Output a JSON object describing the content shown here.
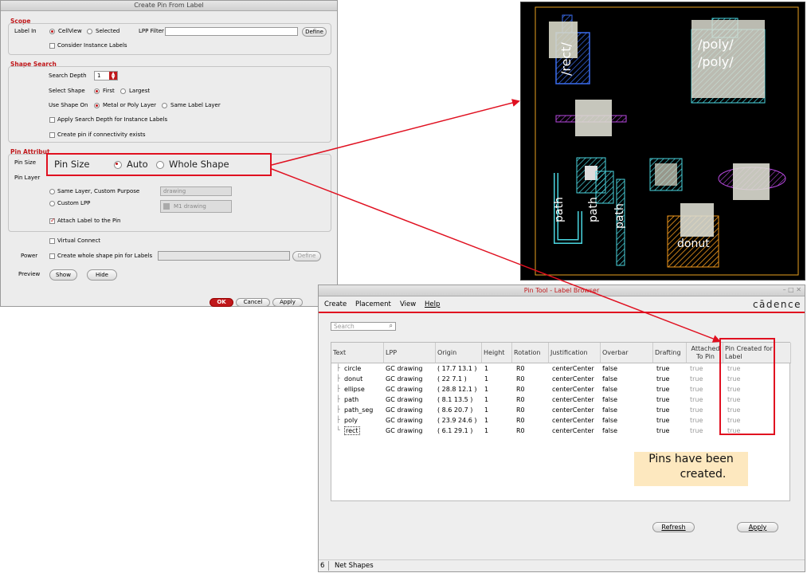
{
  "create_pin_dialog": {
    "title": "Create Pin From Label",
    "scope": {
      "section": "Scope",
      "label_in": "Label In",
      "cellview": "CellView",
      "selected": "Selected",
      "lpp_filter": "LPP Filter",
      "lpp_filter_value": "",
      "define": "Define",
      "consider_instance_labels": "Consider Instance Labels"
    },
    "shape_search": {
      "section": "Shape Search",
      "search_depth": "Search Depth",
      "search_depth_value": "1",
      "select_shape": "Select Shape",
      "first": "First",
      "largest": "Largest",
      "use_shape_on": "Use Shape On",
      "metal_or_poly": "Metal or Poly Layer",
      "same_label_layer": "Same Label Layer",
      "apply_search_depth": "Apply Search Depth for Instance Labels",
      "create_pin_if_connectivity": "Create pin if connectivity exists"
    },
    "pin_attributes": {
      "section": "Pin Attribut",
      "pin_size": "Pin Size",
      "pin_layer": "Pin Layer",
      "same_layer_custom_purpose": "Same Layer, Custom Purpose",
      "custom_purpose_value": "drawing",
      "custom_lpp": "Custom LPP",
      "custom_lpp_value": "M1 drawing",
      "attach_label": "Attach Label to the Pin"
    },
    "virtual_connect": "Virtual Connect",
    "power": "Power",
    "create_whole_shape_pin": "Create whole shape pin for Labels",
    "power_define": "Define",
    "preview": "Preview",
    "show": "Show",
    "hide": "Hide",
    "ok": "OK",
    "cancel": "Cancel",
    "apply": "Apply"
  },
  "zoom_callout": {
    "pin_size": "Pin Size",
    "auto": "Auto",
    "whole_shape": "Whole Shape"
  },
  "layout_view": {
    "labels": [
      "/rect/",
      "/poly/",
      "/poly/",
      "path",
      "path",
      "path",
      "donut"
    ]
  },
  "pin_tool": {
    "title": "Pin Tool - Label Browser",
    "menu": [
      "Create",
      "Placement",
      "View",
      "Help"
    ],
    "brand": "cādence",
    "search_placeholder": "Search",
    "columns": [
      "Text",
      "LPP",
      "Origin",
      "Height",
      "Rotation",
      "Justification",
      "Overbar",
      "Drafting",
      "Attached To Pin",
      "Pin Created for Label"
    ],
    "rows": [
      {
        "text": "circle",
        "lpp": "GC drawing",
        "origin": "( 17.7 13.1 )",
        "height": "1",
        "rotation": "R0",
        "justification": "centerCenter",
        "overbar": "false",
        "drafting": "true",
        "attached": "true",
        "created": "true"
      },
      {
        "text": "donut",
        "lpp": "GC drawing",
        "origin": "( 22 7.1 )",
        "height": "1",
        "rotation": "R0",
        "justification": "centerCenter",
        "overbar": "false",
        "drafting": "true",
        "attached": "true",
        "created": "true"
      },
      {
        "text": "ellipse",
        "lpp": "GC drawing",
        "origin": "( 28.8 12.1 )",
        "height": "1",
        "rotation": "R0",
        "justification": "centerCenter",
        "overbar": "false",
        "drafting": "true",
        "attached": "true",
        "created": "true"
      },
      {
        "text": "path",
        "lpp": "GC drawing",
        "origin": "( 8.1 13.5 )",
        "height": "1",
        "rotation": "R0",
        "justification": "centerCenter",
        "overbar": "false",
        "drafting": "true",
        "attached": "true",
        "created": "true"
      },
      {
        "text": "path_seg",
        "lpp": "GC drawing",
        "origin": "( 8.6 20.7 )",
        "height": "1",
        "rotation": "R0",
        "justification": "centerCenter",
        "overbar": "false",
        "drafting": "true",
        "attached": "true",
        "created": "true"
      },
      {
        "text": "poly",
        "lpp": "GC drawing",
        "origin": "( 23.9 24.6 )",
        "height": "1",
        "rotation": "R0",
        "justification": "centerCenter",
        "overbar": "false",
        "drafting": "true",
        "attached": "true",
        "created": "true"
      },
      {
        "text": "rect",
        "lpp": "GC drawing",
        "origin": "( 6.1 29.1 )",
        "height": "1",
        "rotation": "R0",
        "justification": "centerCenter",
        "overbar": "false",
        "drafting": "true",
        "attached": "true",
        "created": "true"
      }
    ],
    "note": "Pins have been created.",
    "note_line1": "Pins have been",
    "note_line2": "created.",
    "refresh": "Refresh",
    "apply": "Apply",
    "status_count": "6",
    "status_text": "Net Shapes"
  },
  "colors": {
    "accent_red": "#c0181b",
    "callout_red": "#e01020",
    "note_bg": "#fde8bf"
  }
}
